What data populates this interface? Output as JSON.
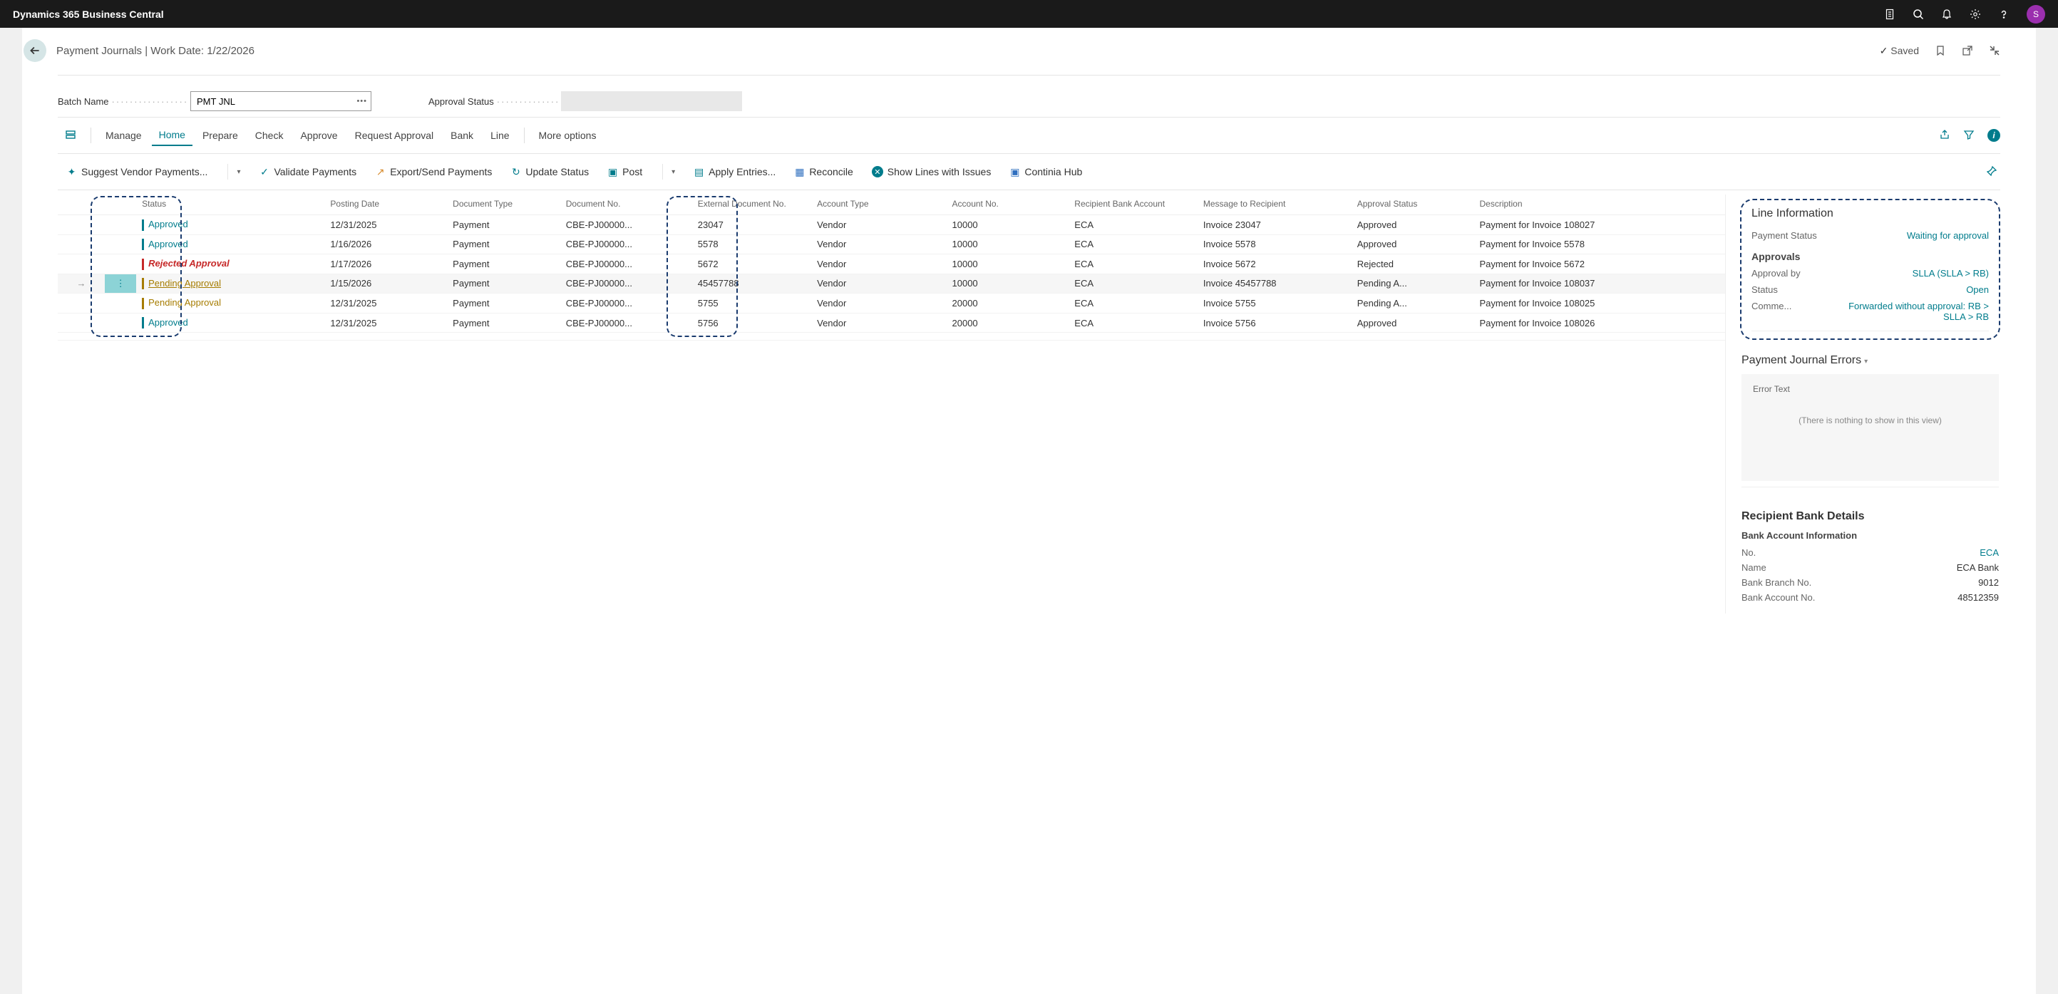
{
  "header": {
    "product": "Dynamics 365 Business Central",
    "avatar_initial": "S"
  },
  "breadcrumb": {
    "text": "Payment Journals | Work Date: 1/22/2026",
    "saved": "Saved"
  },
  "form": {
    "batch_label": "Batch Name",
    "batch_value": "PMT JNL",
    "approval_label": "Approval Status"
  },
  "cmd": {
    "manage": "Manage",
    "home": "Home",
    "prepare": "Prepare",
    "check": "Check",
    "approve": "Approve",
    "request": "Request Approval",
    "bank": "Bank",
    "line": "Line",
    "more": "More options"
  },
  "actions": {
    "suggest": "Suggest Vendor Payments...",
    "validate": "Validate Payments",
    "export": "Export/Send Payments",
    "update": "Update Status",
    "post": "Post",
    "apply": "Apply Entries...",
    "reconcile": "Reconcile",
    "showissues": "Show Lines with Issues",
    "continia": "Continia Hub"
  },
  "columns": {
    "status": "Status",
    "posting": "Posting Date",
    "doctype": "Document Type",
    "docno": "Document No.",
    "extdoc": "External Document No.",
    "acctype": "Account Type",
    "accno": "Account No.",
    "recbank": "Recipient Bank Account",
    "msg": "Message to Recipient",
    "apprstatus": "Approval Status",
    "desc": "Description"
  },
  "rows": [
    {
      "status": "Approved",
      "statusClass": "approved",
      "posting": "12/31/2025",
      "doctype": "Payment",
      "docno": "CBE-PJ00000...",
      "ext": "23047",
      "acctype": "Vendor",
      "accno": "10000",
      "bank": "ECA",
      "msg": "Invoice 23047",
      "appr": "Approved",
      "desc": "Payment for Invoice 108027"
    },
    {
      "status": "Approved",
      "statusClass": "approved",
      "posting": "1/16/2026",
      "doctype": "Payment",
      "docno": "CBE-PJ00000...",
      "ext": "5578",
      "acctype": "Vendor",
      "accno": "10000",
      "bank": "ECA",
      "msg": "Invoice 5578",
      "appr": "Approved",
      "desc": "Payment for Invoice 5578"
    },
    {
      "status": "Rejected Approval",
      "statusClass": "rejected",
      "posting": "1/17/2026",
      "doctype": "Payment",
      "docno": "CBE-PJ00000...",
      "ext": "5672",
      "acctype": "Vendor",
      "accno": "10000",
      "bank": "ECA",
      "msg": "Invoice 5672",
      "appr": "Rejected",
      "desc": "Payment for Invoice 5672"
    },
    {
      "status": "Pending Approval",
      "statusClass": "pending",
      "posting": "1/15/2026",
      "doctype": "Payment",
      "docno": "CBE-PJ00000...",
      "ext": "45457788",
      "acctype": "Vendor",
      "accno": "10000",
      "bank": "ECA",
      "msg": "Invoice 45457788",
      "appr": "Pending A...",
      "desc": "Payment for Invoice 108037",
      "selected": true
    },
    {
      "status": "Pending Approval",
      "statusClass": "pending",
      "posting": "12/31/2025",
      "doctype": "Payment",
      "docno": "CBE-PJ00000...",
      "ext": "5755",
      "acctype": "Vendor",
      "accno": "20000",
      "bank": "ECA",
      "msg": "Invoice 5755",
      "appr": "Pending A...",
      "desc": "Payment for Invoice 108025"
    },
    {
      "status": "Approved",
      "statusClass": "approved",
      "posting": "12/31/2025",
      "doctype": "Payment",
      "docno": "CBE-PJ00000...",
      "ext": "5756",
      "acctype": "Vendor",
      "accno": "20000",
      "bank": "ECA",
      "msg": "Invoice 5756",
      "appr": "Approved",
      "desc": "Payment for Invoice 108026"
    }
  ],
  "factbox": {
    "line_info_title": "Line Information",
    "pay_status_k": "Payment Status",
    "pay_status_v": "Waiting for approval",
    "approvals_title": "Approvals",
    "appr_by_k": "Approval by",
    "appr_by_v": "SLLA    (SLLA > RB)",
    "status_k": "Status",
    "status_v": "Open",
    "comment_k": "Comme...",
    "comment_v": "Forwarded without approval: RB > SLLA > RB",
    "errors_title": "Payment Journal Errors",
    "errors_header": "Error Text",
    "errors_empty": "(There is nothing to show in this view)",
    "bank_title": "Recipient Bank Details",
    "bank_info": "Bank Account Information",
    "bank_no_k": "No.",
    "bank_no_v": "ECA",
    "bank_name_k": "Name",
    "bank_name_v": "ECA Bank",
    "bank_branch_k": "Bank Branch No.",
    "bank_branch_v": "9012",
    "bank_acc_k": "Bank Account No.",
    "bank_acc_v": "48512359"
  }
}
